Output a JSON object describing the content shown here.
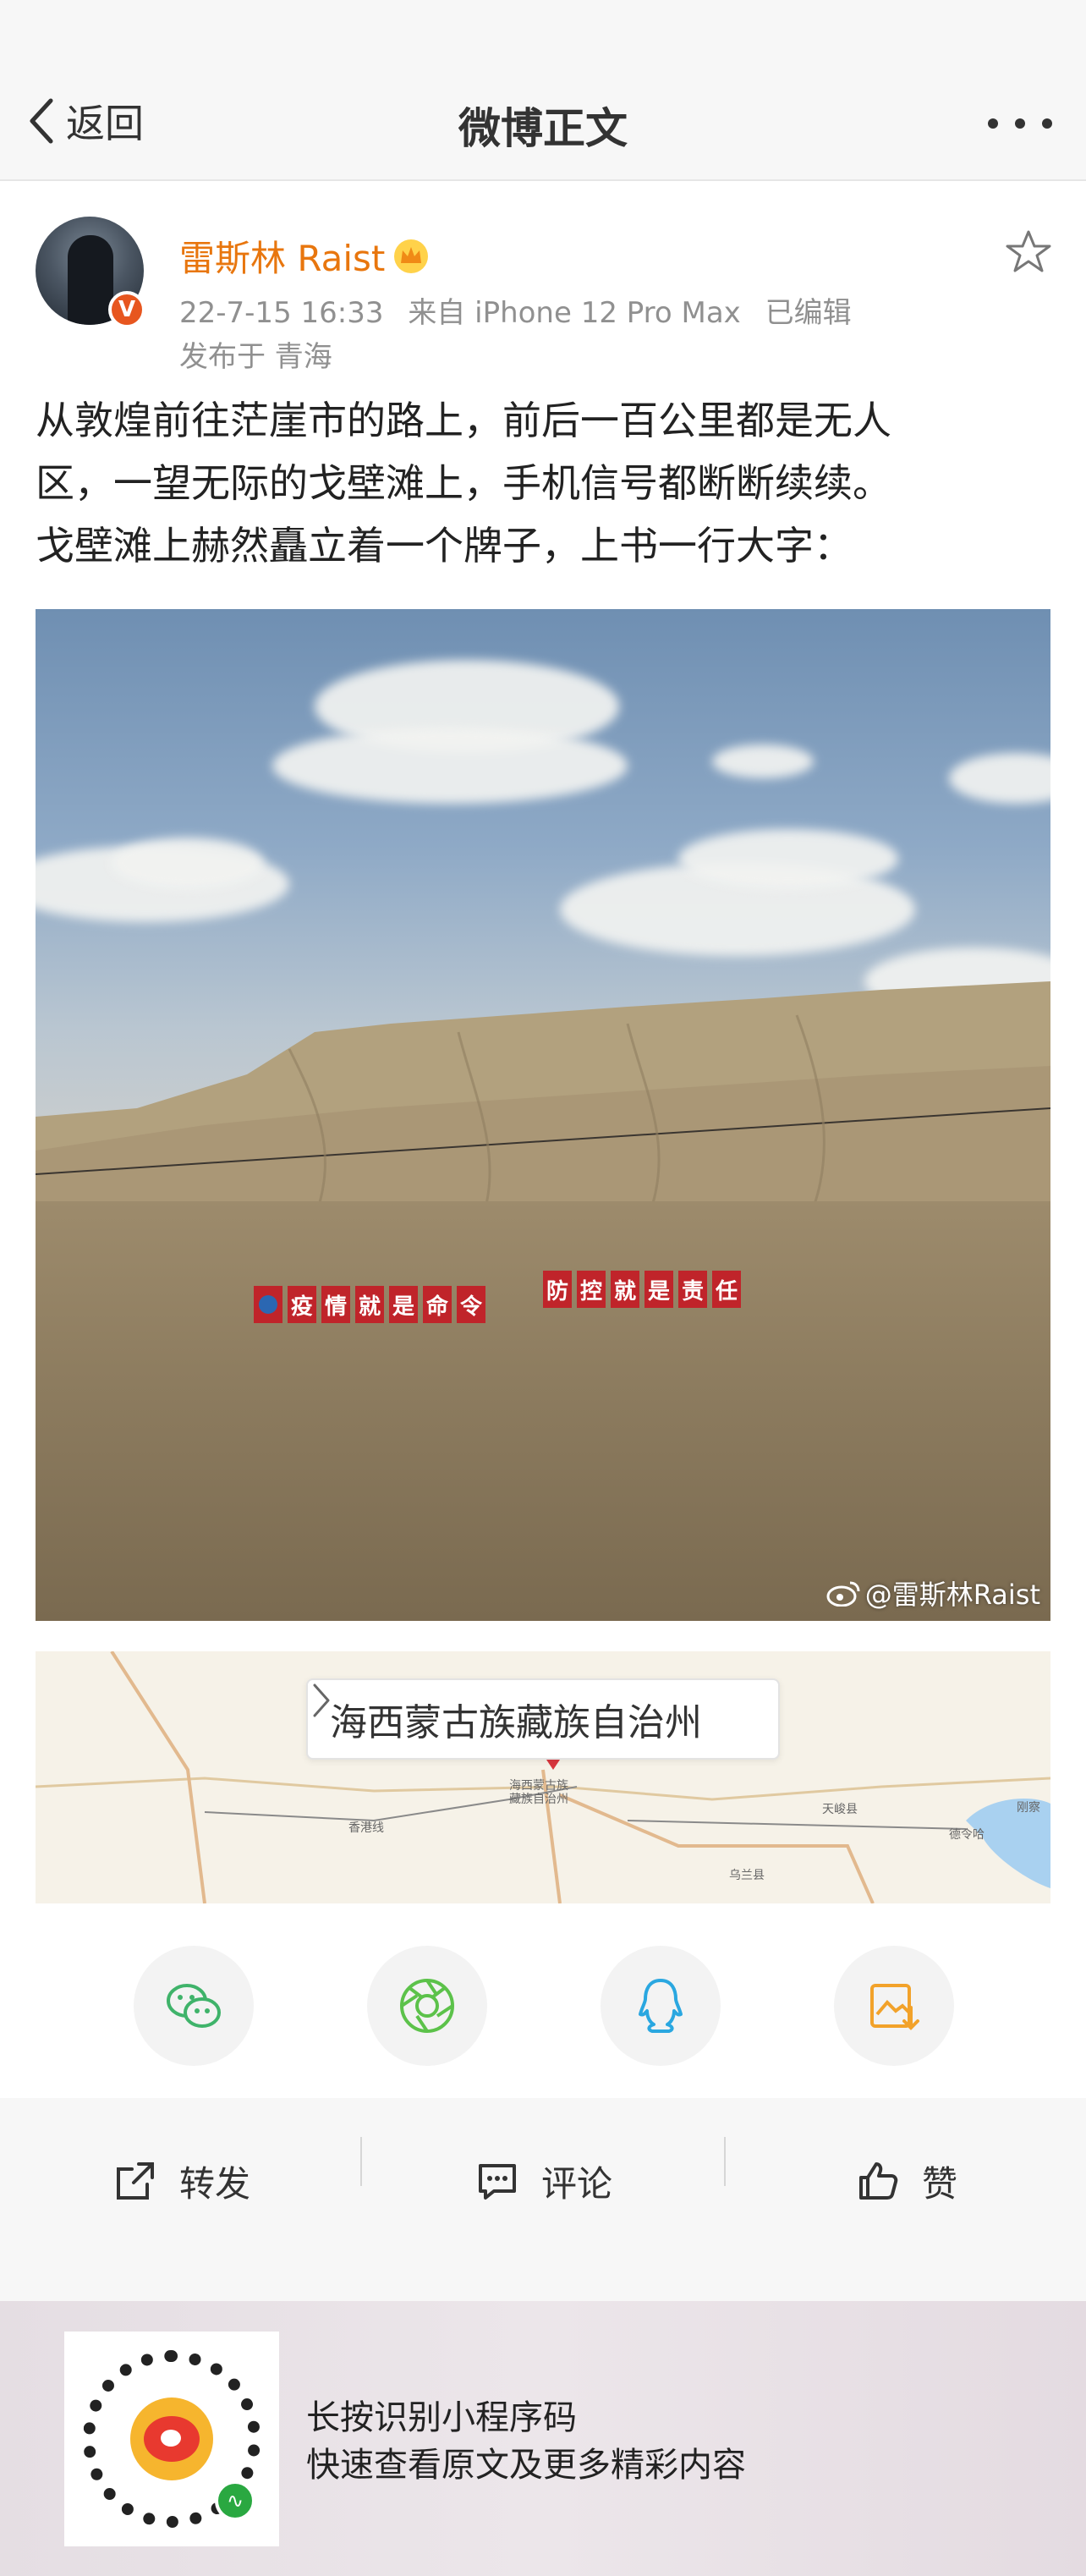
{
  "nav": {
    "back_label": "返回",
    "title": "微博正文"
  },
  "post": {
    "author": "雷斯林 Raist",
    "verified_mark": "V",
    "time": "22-7-15 16:33",
    "source": "来自 iPhone 12 Pro Max",
    "edited": "已编辑",
    "location": "发布于 青海",
    "text_lines": [
      "从敦煌前往茫崖市的路上，前后一百公里都是无人",
      "区，一望无际的戈壁滩上，手机信号都断断续续。",
      "戈壁滩上赫然矗立着一个牌子，上书一行大字："
    ]
  },
  "photo": {
    "banner_left": [
      "疫",
      "情",
      "就",
      "是",
      "命",
      "令"
    ],
    "banner_right": [
      "防",
      "控",
      "就",
      "是",
      "责",
      "任"
    ],
    "watermark": "@雷斯林Raist"
  },
  "map": {
    "place": "海西蒙古族藏族自治州",
    "labels": [
      "海西蒙古族",
      "藏族自治州",
      "天峻县",
      "刚察",
      "乌兰县",
      "德令哈",
      "香港线"
    ]
  },
  "share": {
    "items": [
      "wechat-icon",
      "moments-icon",
      "qq-icon",
      "save-image-icon"
    ],
    "colors": {
      "wechat": "#3fb36a",
      "moments": "#5cc24a",
      "qq": "#2aa7e0",
      "save": "#f2a22a"
    }
  },
  "actions": {
    "repost": "转发",
    "comment": "评论",
    "like": "赞"
  },
  "footer": {
    "line1": "长按识别小程序码",
    "line2": "快速查看原文及更多精彩内容"
  },
  "colors": {
    "username": "#e8760e",
    "meta": "#909090",
    "accent_red": "#c0242a"
  }
}
